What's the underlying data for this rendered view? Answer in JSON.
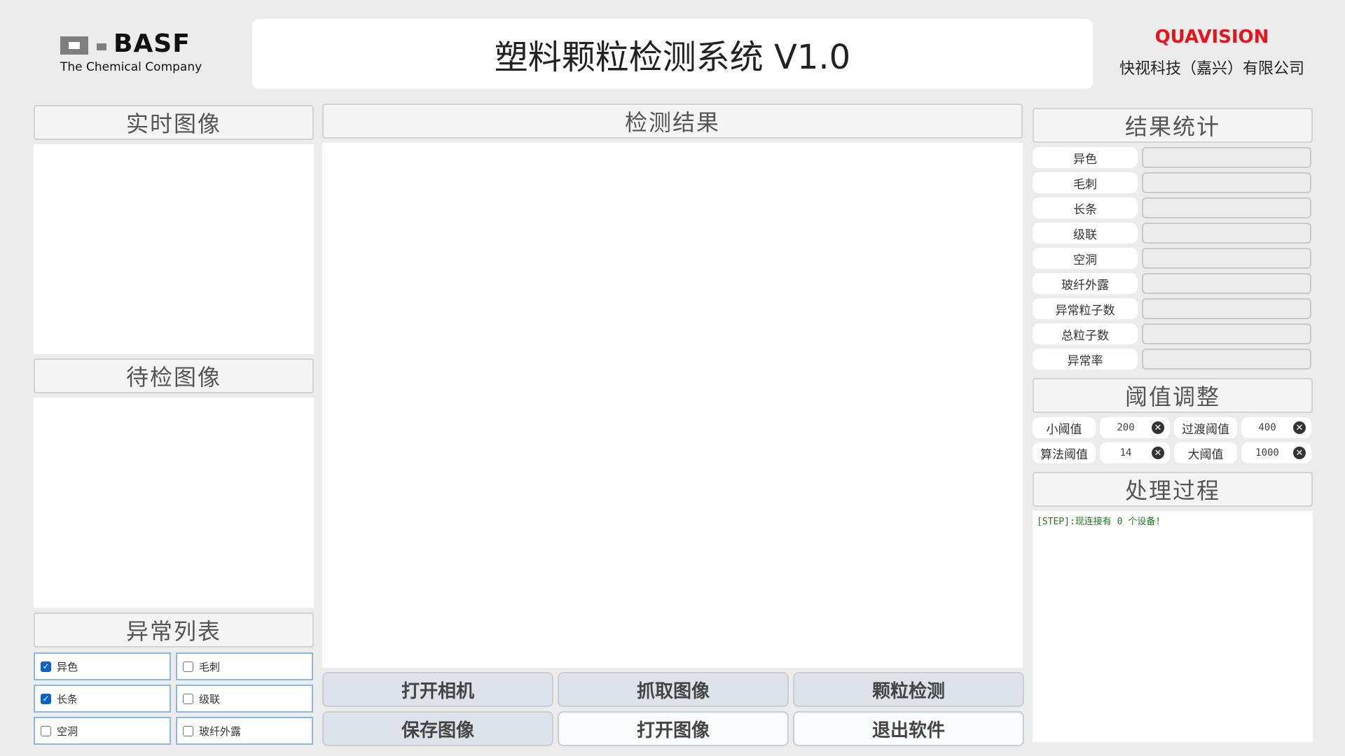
{
  "header": {
    "basf_name": "BASF",
    "basf_tagline": "The Chemical Company",
    "title": "塑料颗粒检测系统 V1.0",
    "brand": "QUAVISION",
    "company": "快视科技（嘉兴）有限公司",
    "brand_color": "#e8141c"
  },
  "left": {
    "realtime_title": "实时图像",
    "pending_title": "待检图像",
    "anomaly_title": "异常列表",
    "anomaly_items": [
      {
        "label": "异色",
        "checked": true
      },
      {
        "label": "毛刺",
        "checked": false
      },
      {
        "label": "长条",
        "checked": true
      },
      {
        "label": "级联",
        "checked": false
      },
      {
        "label": "空洞",
        "checked": false
      },
      {
        "label": "玻纤外露",
        "checked": false
      }
    ]
  },
  "center": {
    "result_title": "检测结果",
    "buttons": [
      "打开相机",
      "抓取图像",
      "颗粒检测",
      "保存图像",
      "打开图像",
      "退出软件"
    ]
  },
  "right": {
    "stats_title": "结果统计",
    "stats": [
      {
        "label": "异色",
        "value": ""
      },
      {
        "label": "毛刺",
        "value": ""
      },
      {
        "label": "长条",
        "value": ""
      },
      {
        "label": "级联",
        "value": ""
      },
      {
        "label": "空洞",
        "value": ""
      },
      {
        "label": "玻纤外露",
        "value": ""
      },
      {
        "label": "异常粒子数",
        "value": ""
      },
      {
        "label": "总粒子数",
        "value": ""
      },
      {
        "label": "异常率",
        "value": ""
      }
    ],
    "threshold_title": "阈值调整",
    "thresholds": [
      {
        "label": "小阈值",
        "value": "200"
      },
      {
        "label": "过渡阈值",
        "value": "400"
      },
      {
        "label": "算法阈值",
        "value": "14"
      },
      {
        "label": "大阈值",
        "value": "1000"
      }
    ],
    "process_title": "处理过程",
    "log_lines": [
      "[STEP]:现连接有 0 个设备!"
    ]
  }
}
